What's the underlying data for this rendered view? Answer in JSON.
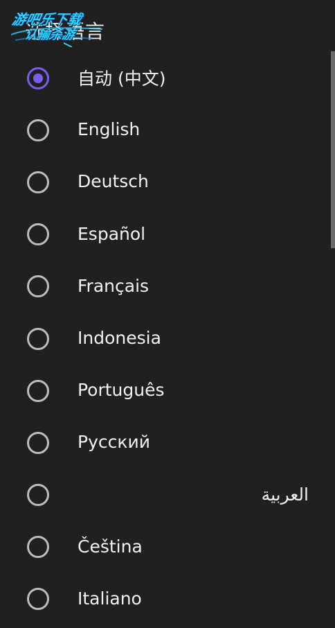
{
  "header": {
    "title": "选择语言",
    "watermark_line1": "游吧乐下载",
    "watermark_line2": "认输杀游"
  },
  "languages": [
    {
      "label": "自动 (中文)",
      "selected": true
    },
    {
      "label": "English",
      "selected": false
    },
    {
      "label": "Deutsch",
      "selected": false
    },
    {
      "label": "Español",
      "selected": false
    },
    {
      "label": "Français",
      "selected": false
    },
    {
      "label": "Indonesia",
      "selected": false
    },
    {
      "label": "Português",
      "selected": false
    },
    {
      "label": "Русский",
      "selected": false
    },
    {
      "label": "العربية",
      "selected": false
    },
    {
      "label": "Čeština",
      "selected": false
    },
    {
      "label": "Italiano",
      "selected": false
    }
  ],
  "colors": {
    "background": "#202020",
    "accent": "#7c5cf0",
    "radio_border": "#bdbdbd",
    "text": "#f2f2f2",
    "watermark": "#2ad4ff"
  }
}
